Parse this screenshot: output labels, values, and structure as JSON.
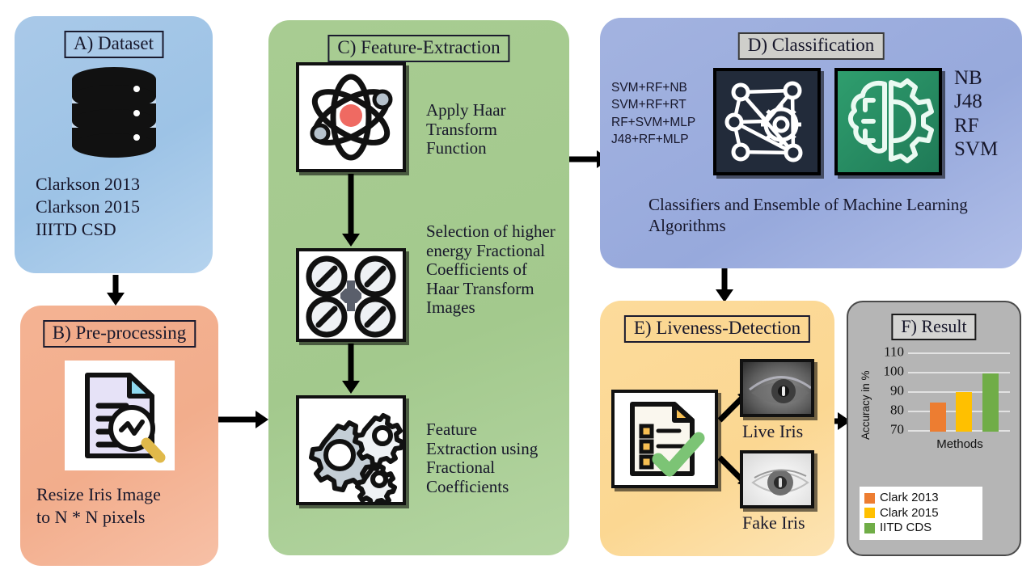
{
  "panels": {
    "a": {
      "header": "A) Dataset",
      "icon": "database-icon",
      "lines": [
        "Clarkson 2013",
        "Clarkson 2015",
        "IIITD CSD"
      ],
      "color": "#9dc3e6"
    },
    "b": {
      "header": "B) Pre-processing",
      "icon": "document-magnifier-icon",
      "lines": [
        "Resize Iris Image",
        "to N * N pixels"
      ],
      "color": "#f2ad8c"
    },
    "c": {
      "header": "C) Feature-Extraction",
      "color": "#a3c98d",
      "steps": [
        {
          "icon": "atom-icon",
          "text": "Apply Haar Transform Function"
        },
        {
          "icon": "coefficients-icon",
          "text": "Selection of higher energy Fractional Coefficients of Haar Transform Images"
        },
        {
          "icon": "gears-icon",
          "text": "Feature Extraction using Fractional Coefficients"
        }
      ]
    },
    "d": {
      "header": "D) Classification",
      "color": "#97a9dc",
      "ensembles": [
        "SVM+RF+NB",
        "SVM+RF+RT",
        "RF+SVM+MLP",
        "J48+RF+MLP"
      ],
      "classifiers": [
        "NB",
        "J48",
        "RF",
        "SVM"
      ],
      "icons": [
        "neural-network-icon",
        "brain-gear-icon"
      ],
      "caption": "Classifiers and Ensemble of Machine Learning Algorithms"
    },
    "e": {
      "header": "E) Liveness-Detection",
      "color": "#fbd792",
      "icon": "checklist-icon",
      "live_label": "Live Iris",
      "fake_label": "Fake Iris"
    },
    "f": {
      "header": "F) Result",
      "color": "#b5b5b5"
    }
  },
  "chart_data": {
    "type": "bar",
    "title": "F) Result",
    "xlabel": "Methods",
    "ylabel": "Accuracy in %",
    "categories": [
      "Clark 2013",
      "Clark 2015",
      "IITD CDS"
    ],
    "values": [
      85,
      90.5,
      100
    ],
    "ylim": [
      70,
      110
    ],
    "yticks": [
      70,
      80,
      90,
      100,
      110
    ],
    "grid": true,
    "legend_position": "bottom",
    "colors": [
      "#ed7d31",
      "#ffc000",
      "#70ad47"
    ],
    "series": [
      {
        "name": "Clark 2013",
        "values": [
          85
        ],
        "color": "#ed7d31"
      },
      {
        "name": "Clark 2015",
        "values": [
          90.5
        ],
        "color": "#ffc000"
      },
      {
        "name": "IITD CDS",
        "values": [
          100
        ],
        "color": "#70ad47"
      }
    ]
  }
}
